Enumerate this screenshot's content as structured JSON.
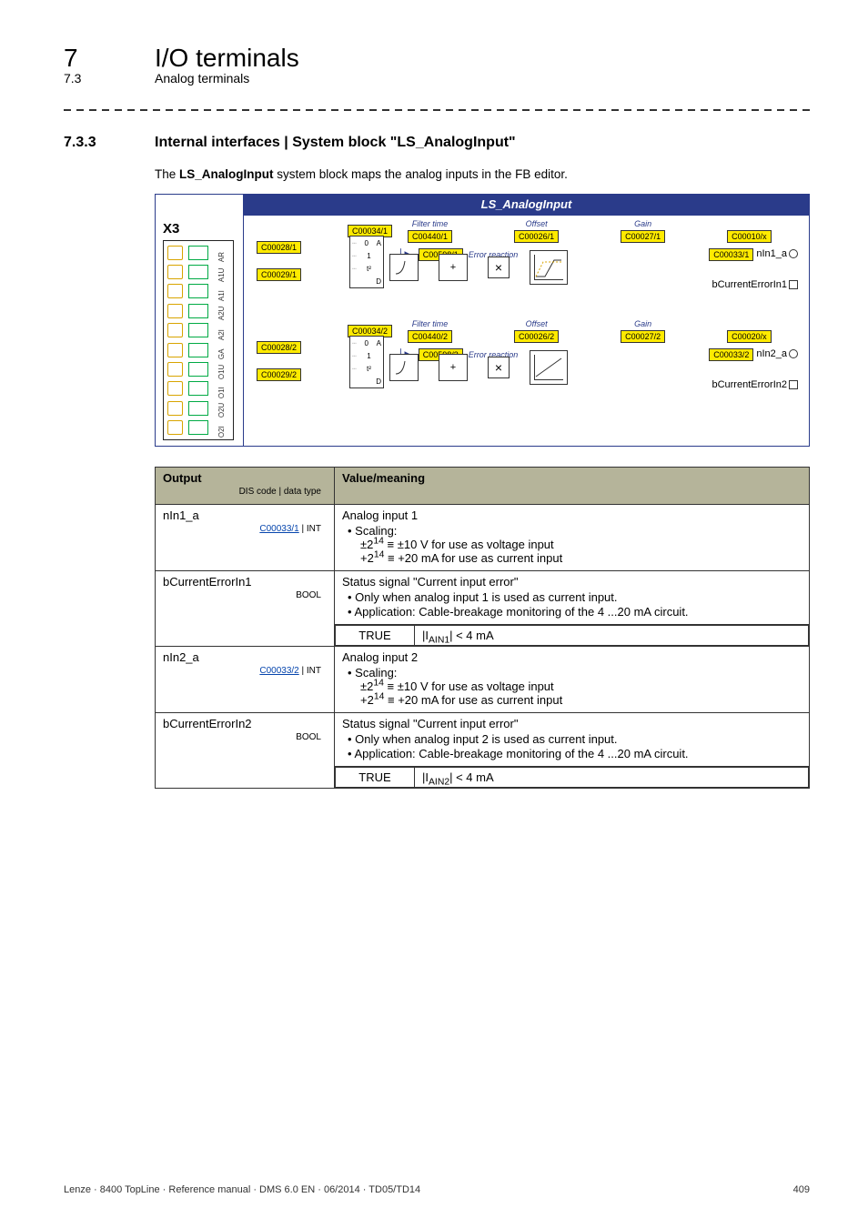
{
  "header": {
    "chapter_number": "7",
    "chapter_title": "I/O terminals",
    "section_number": "7.3",
    "section_title": "Analog terminals"
  },
  "section": {
    "number": "7.3.3",
    "title": "Internal interfaces | System block \"LS_AnalogInput\"",
    "intro_prefix": "The ",
    "intro_bold": "LS_AnalogInput",
    "intro_suffix": " system block maps the analog inputs in the FB editor."
  },
  "diagram": {
    "title": "LS_AnalogInput",
    "x3_label": "X3",
    "terminals": [
      "AR",
      "A1U",
      "A1I",
      "A2U",
      "A2I",
      "GA",
      "O1U",
      "O1I",
      "O2U",
      "O2I"
    ],
    "labels": {
      "filter_time": "Filter time",
      "offset": "Offset",
      "gain": "Gain",
      "error_reaction": "Error reaction"
    },
    "mux": {
      "n0": "0",
      "n1": "1",
      "nt2": "t²",
      "a": "A",
      "d": "D"
    },
    "ch1": {
      "c_sel": "C00034/1",
      "c_filter": "C00440/1",
      "c_offset": "C00026/1",
      "c_gain": "C00027/1",
      "c_curve": "C00010/x",
      "c_in_a": "C00028/1",
      "c_in_b": "C00029/1",
      "c_err": "C00598/1",
      "c_out": "C00033/1",
      "out_sig": "nIn1_a",
      "out_err": "bCurrentErrorIn1"
    },
    "ch2": {
      "c_sel": "C00034/2",
      "c_filter": "C00440/2",
      "c_offset": "C00026/2",
      "c_gain": "C00027/2",
      "c_curve": "C00020/x",
      "c_in_a": "C00028/2",
      "c_in_b": "C00029/2",
      "c_err": "C00598/2",
      "c_out": "C00033/2",
      "out_sig": "nIn2_a",
      "out_err": "bCurrentErrorIn2"
    }
  },
  "table": {
    "headers": {
      "output": "Output",
      "value": "Value/meaning",
      "dis_header": "DIS code | data type"
    },
    "types": {
      "int": "INT",
      "bool": "BOOL"
    },
    "sep": " | ",
    "r1": {
      "name": "nIn1_a",
      "dis_link": "C00033/1",
      "l1": "Analog input 1",
      "l2": "Scaling:",
      "l3_pre": "±2",
      "l3_mid": " ≡ ±10 V for use as voltage input",
      "l4_pre": "+2",
      "l4_mid": " ≡ +20 mA for use as current input",
      "exp": "14"
    },
    "r2": {
      "name": "bCurrentErrorIn1",
      "l1": "Status signal \"Current input error\"",
      "l2": "Only when analog input 1 is used as current input.",
      "l3": "Application: Cable-breakage monitoring of the 4 ...20 mA circuit.",
      "true_label": "TRUE",
      "true_cond_pre": "|I",
      "true_cond_sub": "AIN1",
      "true_cond_post": "| < 4 mA"
    },
    "r3": {
      "name": "nIn2_a",
      "dis_link": "C00033/2",
      "l1": "Analog input 2",
      "l2": "Scaling:",
      "l3_pre": "±2",
      "l3_mid": " ≡ ±10 V for use as voltage input",
      "l4_pre": "+2",
      "l4_mid": " ≡ +20 mA for use as current input",
      "exp": "14"
    },
    "r4": {
      "name": "bCurrentErrorIn2",
      "l1": "Status signal \"Current input error\"",
      "l2": "Only when analog input 2 is used as current input.",
      "l3": "Application: Cable-breakage monitoring of the 4 ...20 mA circuit.",
      "true_label": "TRUE",
      "true_cond_pre": "|I",
      "true_cond_sub": "AIN2",
      "true_cond_post": "| < 4 mA"
    }
  },
  "footer": {
    "left": "Lenze · 8400 TopLine · Reference manual · DMS 6.0 EN · 06/2014 · TD05/TD14",
    "right": "409"
  },
  "chart_data": null
}
